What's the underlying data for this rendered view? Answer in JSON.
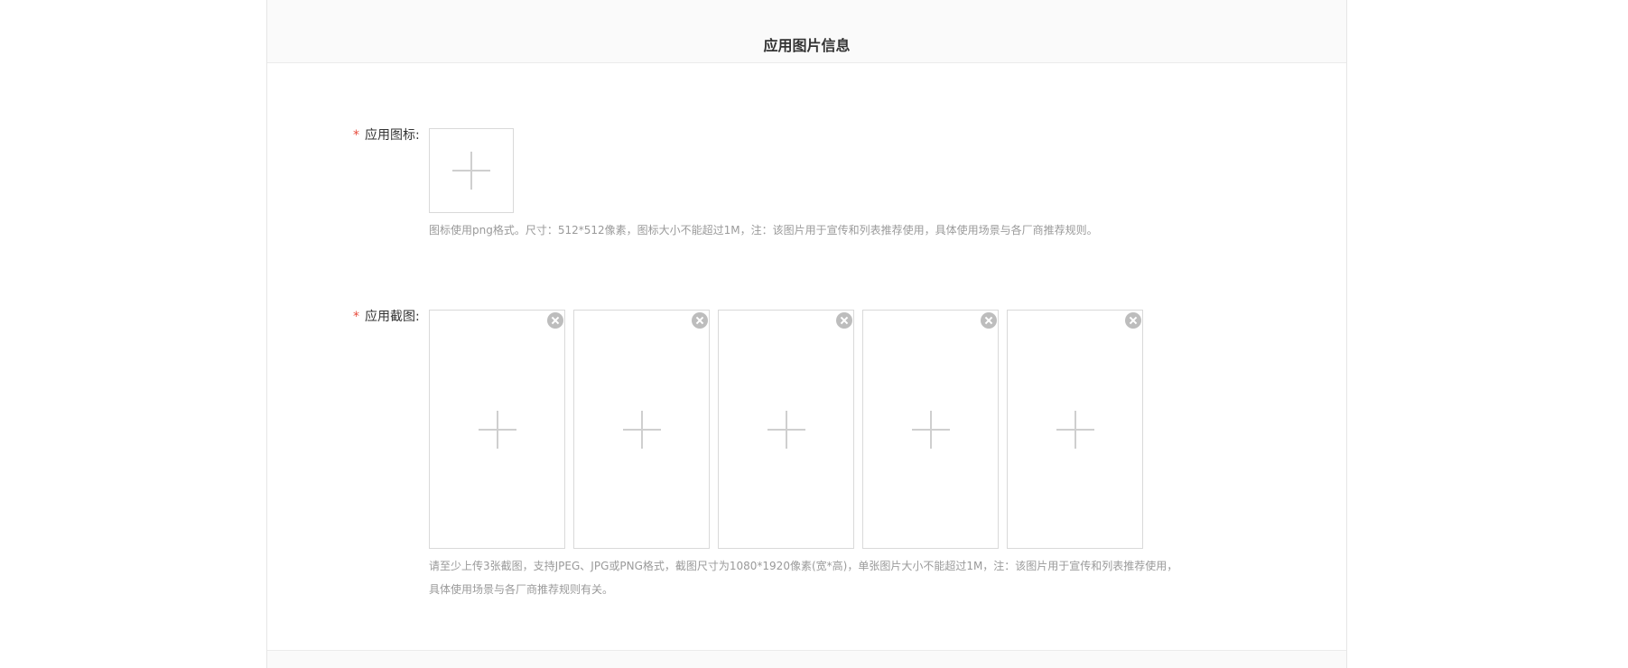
{
  "section": {
    "title": "应用图片信息"
  },
  "icon_field": {
    "required_mark": "*",
    "label": "应用图标:",
    "hint": "图标使用png格式。尺寸：512*512像素，图标大小不能超过1M，注：该图片用于宣传和列表推荐使用，具体使用场景与各厂商推荐规则。"
  },
  "screenshot_field": {
    "required_mark": "*",
    "label": "应用截图:",
    "slots": [
      {
        "icon": "plus-icon",
        "remove_icon": "close-circle-icon"
      },
      {
        "icon": "plus-icon",
        "remove_icon": "close-circle-icon"
      },
      {
        "icon": "plus-icon",
        "remove_icon": "close-circle-icon"
      },
      {
        "icon": "plus-icon",
        "remove_icon": "close-circle-icon"
      },
      {
        "icon": "plus-icon",
        "remove_icon": "close-circle-icon"
      }
    ],
    "hint_line1": "请至少上传3张截图，支持JPEG、JPG或PNG格式，截图尺寸为1080*1920像素(宽*高)，单张图片大小不能超过1M，注：该图片用于宣传和列表推荐使用，",
    "hint_line2": "具体使用场景与各厂商推荐规则有关。"
  },
  "colors": {
    "required_star": "#e84c3d",
    "hint_text": "#9a9a9a",
    "border": "#d9d9d9"
  }
}
